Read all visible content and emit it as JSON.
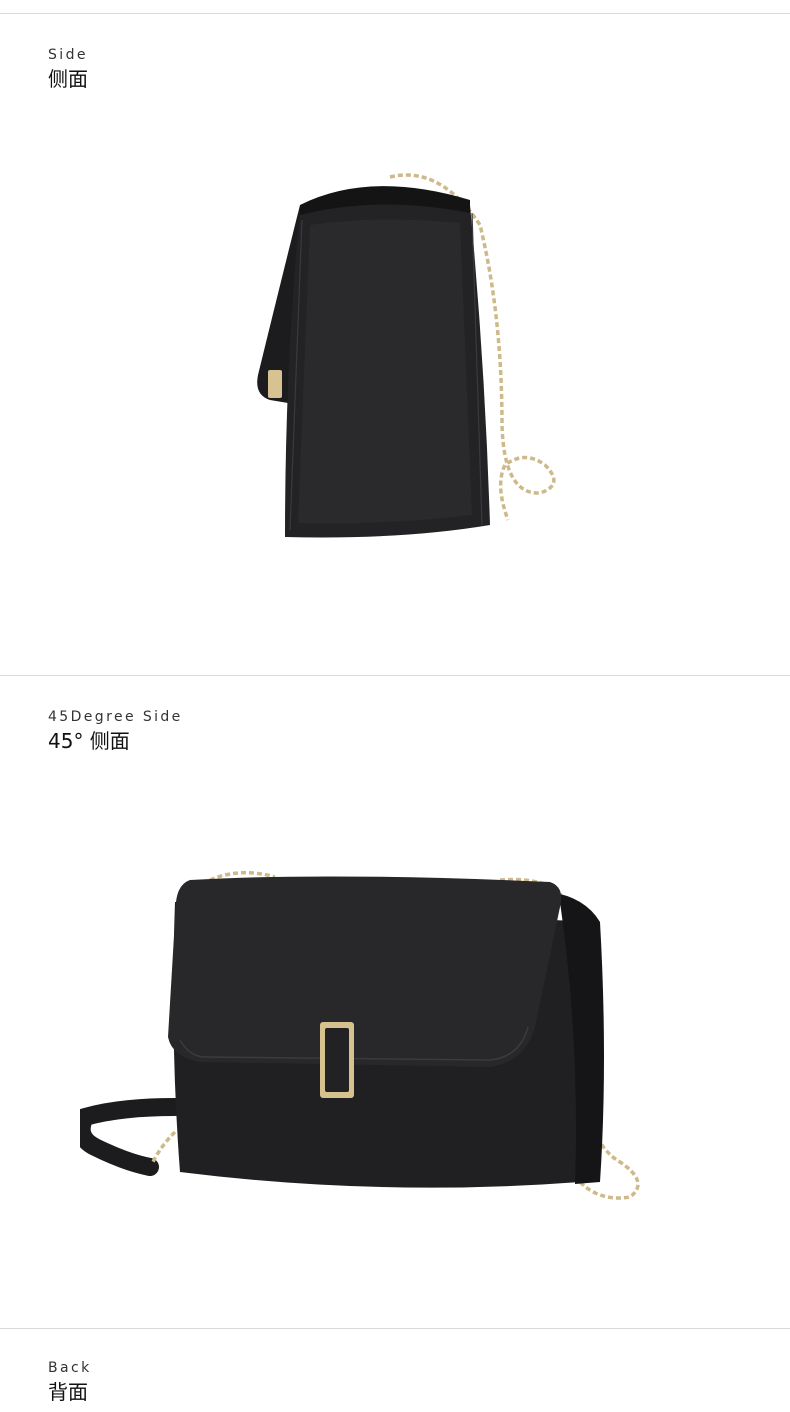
{
  "sections": [
    {
      "label_en": "Side",
      "label_zh": "侧面",
      "image": "bag-side-view"
    },
    {
      "label_en": "45Degree Side",
      "label_zh": "45°  侧面",
      "image": "bag-45-degree-view"
    },
    {
      "label_en": "Back",
      "label_zh": "背面",
      "image": "bag-back-view"
    }
  ],
  "colors": {
    "leather": "#1f1f21",
    "leather_light": "#2e2e31",
    "chain_gold": "#cdb98a",
    "divider": "#d9d9d9",
    "background": "#ffffff"
  }
}
